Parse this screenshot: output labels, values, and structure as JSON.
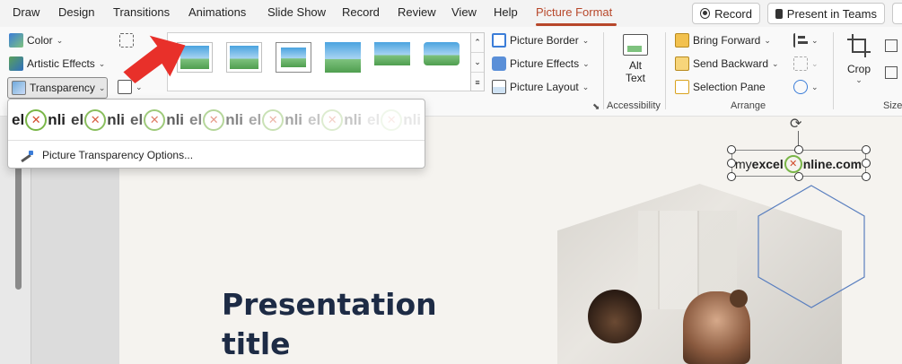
{
  "menu": {
    "tabs": [
      "Draw",
      "Design",
      "Transitions",
      "Animations",
      "Slide Show",
      "Record",
      "Review",
      "View",
      "Help",
      "Picture Format"
    ],
    "active_tab": "Picture Format",
    "record_button": "Record",
    "present_button": "Present in Teams"
  },
  "ribbon": {
    "adjust": {
      "color": "Color",
      "artistic_effects": "Artistic Effects",
      "transparency": "Transparency"
    },
    "picture_styles": {
      "border": "Picture Border",
      "effects": "Picture Effects",
      "layout": "Picture Layout"
    },
    "accessibility": {
      "alt_text_line1": "Alt",
      "alt_text_line2": "Text",
      "label": "Accessibility"
    },
    "arrange": {
      "bring_forward": "Bring Forward",
      "send_backward": "Send Backward",
      "selection_pane": "Selection Pane",
      "label": "Arrange"
    },
    "size": {
      "crop": "Crop",
      "label": "Size"
    }
  },
  "transparency_dropdown": {
    "presets_text": [
      "el",
      "nli",
      "el",
      "nli",
      "el",
      "nli",
      "el",
      "nli",
      "el",
      "nli",
      "el",
      "nli",
      "el",
      "nli"
    ],
    "options_link": "Picture Transparency Options..."
  },
  "slide": {
    "title_line1": "Presentation",
    "title_line2": "title",
    "logo_prefix": "my",
    "logo_excel": "excel",
    "logo_suffix": "nline.com"
  },
  "colors": {
    "accent": "#b7472a",
    "arrow": "#e8302a",
    "title": "#1d2b45",
    "hex_outline": "#5a7fbf"
  }
}
